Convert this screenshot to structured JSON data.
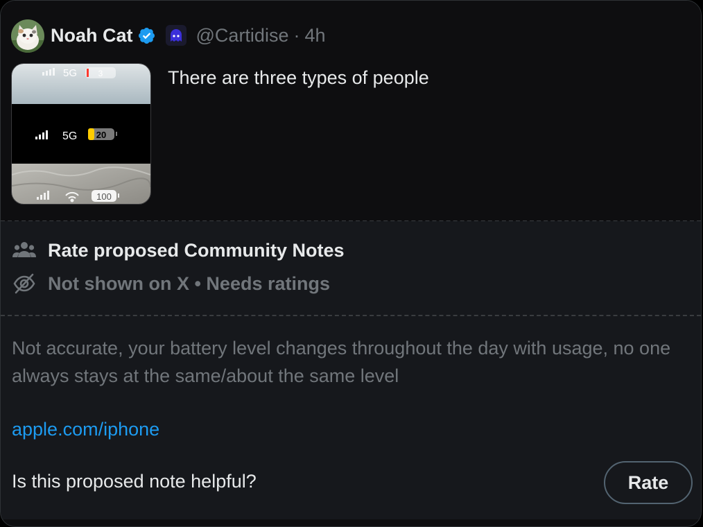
{
  "tweet": {
    "author_name": "Noah Cat",
    "verified": true,
    "affiliate_badge": "ghost-icon",
    "handle": "@Cartidise",
    "separator": "·",
    "time": "4h",
    "text": "There are three types of people",
    "media": {
      "panels": [
        {
          "network": "5G",
          "battery": "3"
        },
        {
          "network": "5G",
          "battery": "20"
        },
        {
          "network": "wifi",
          "battery": "100"
        }
      ]
    }
  },
  "community_notes": {
    "header": {
      "icon": "people-group-icon",
      "title": "Rate proposed Community Notes"
    },
    "status": {
      "icon": "eye-slash-icon",
      "text": "Not shown on X • Needs ratings"
    },
    "note_text": "Not accurate, your battery level changes throughout the day with usage, no one always stays at the same/about the same level",
    "link": "apple.com/iphone",
    "question": "Is this proposed note helpful?",
    "rate_label": "Rate"
  },
  "colors": {
    "background": "#0e0e10",
    "notes_background": "#16181c",
    "primary_text": "#e7e9ea",
    "secondary_text": "#71767b",
    "link": "#1d9bf0",
    "verified": "#1d9bf0",
    "battery_low": "#ff3b30",
    "battery_mid": "#ffcc00"
  }
}
